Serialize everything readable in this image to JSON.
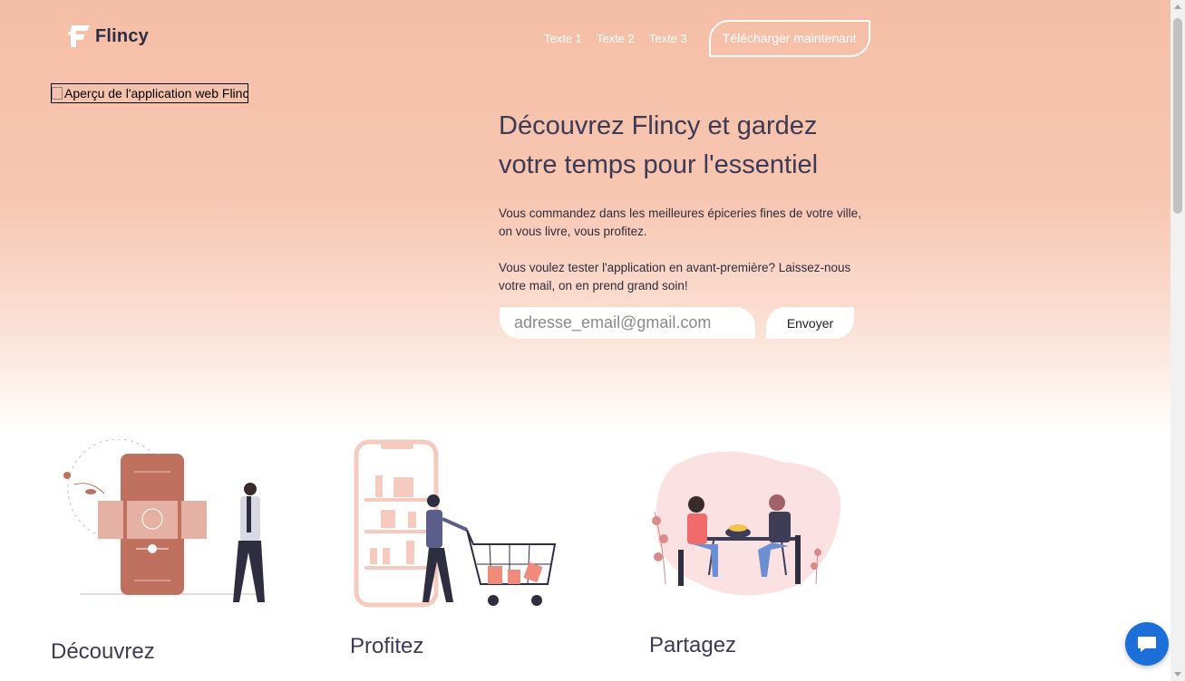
{
  "brand": {
    "name": "Flincy"
  },
  "nav": {
    "links": [
      "Texte 1",
      "Texte 2",
      "Texte 3"
    ],
    "cta_label": "Télécharger maintenant"
  },
  "hero": {
    "image_alt": "Aperçu de l'application web Flincy",
    "headline": "Découvrez Flincy et gardez votre temps pour l'essentiel",
    "paragraph1": "Vous commandez dans les meilleures épiceries fines de votre ville, on vous livre, vous profitez.",
    "paragraph2": "Vous voulez tester l'application en avant-première? Laissez-nous votre mail, on en prend grand soin!",
    "email_placeholder": "adresse_email@gmail.com",
    "send_label": "Envoyer"
  },
  "features": [
    {
      "title": "Découvrez"
    },
    {
      "title": "Profitez"
    },
    {
      "title": "Partagez"
    }
  ],
  "colors": {
    "accent": "#c0705f",
    "hero_top": "#f5bea6",
    "heading": "#3d3a56",
    "chat": "#1c6fd8"
  },
  "icons": {
    "logo": "flincy-f-logo-icon",
    "chat": "chat-bubble-icon",
    "broken_image": "broken-image-icon"
  }
}
